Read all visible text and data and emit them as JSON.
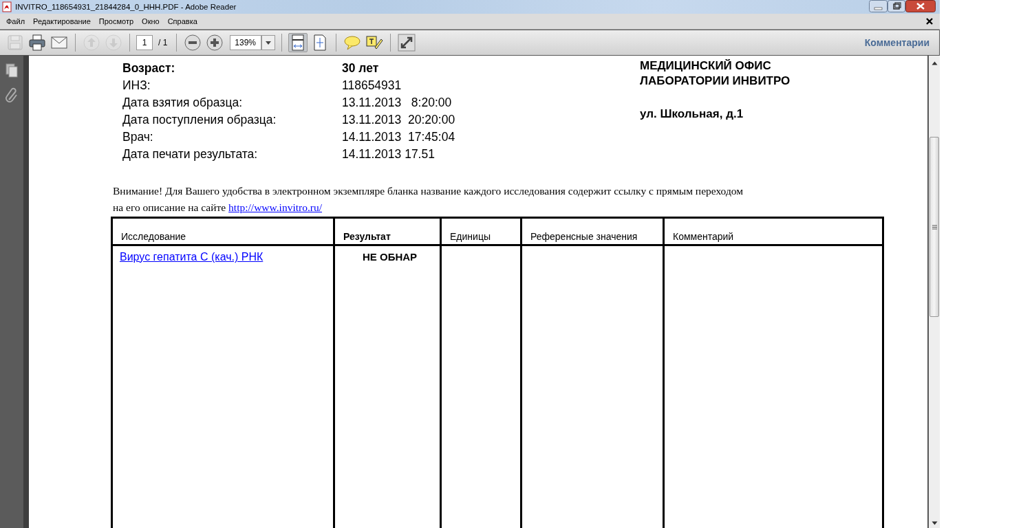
{
  "window": {
    "title": "INVITRO_118654931_21844284_0_HHH.PDF - Adobe Reader"
  },
  "menu": {
    "items": [
      "Файл",
      "Редактирование",
      "Просмотр",
      "Окно",
      "Справка"
    ]
  },
  "toolbar": {
    "groups": [
      [
        {
          "kind": "save",
          "disabled": true
        },
        {
          "kind": "print",
          "disabled": false
        },
        {
          "kind": "email",
          "disabled": false
        }
      ],
      [
        {
          "kind": "prev",
          "disabled": true
        },
        {
          "kind": "next",
          "disabled": true
        }
      ],
      [
        {
          "kind": "page"
        }
      ],
      [
        {
          "kind": "zoom-out",
          "disabled": false
        },
        {
          "kind": "zoom-in",
          "disabled": false
        },
        {
          "kind": "zoom"
        }
      ],
      [
        {
          "kind": "fit-width",
          "selected": true
        },
        {
          "kind": "fit-page",
          "selected": false
        }
      ],
      [
        {
          "kind": "comment",
          "disabled": false
        },
        {
          "kind": "highlight",
          "disabled": false
        }
      ],
      [
        {
          "kind": "fullscreen",
          "disabled": false
        }
      ]
    ],
    "page_number": "1",
    "page_total": "/ 1",
    "zoom": "139%",
    "comments": "Комментарии"
  },
  "document": {
    "fields": [
      {
        "label": "Возраст:",
        "value": "30 лет",
        "bold": true
      },
      {
        "label": "ИНЗ:",
        "value": "118654931",
        "bold": false
      },
      {
        "label": "Дата взятия образца:",
        "value": "13.11.2013   8:20:00",
        "bold": false
      },
      {
        "label": "Дата поступления образца:",
        "value": "13.11.2013  20:20:00",
        "bold": false
      },
      {
        "label": "Врач:",
        "value": "14.11.2013  17:45:04",
        "bold": false
      },
      {
        "label": "Дата печати результата:",
        "value": "14.11.2013 17.51",
        "bold": false
      }
    ],
    "office": [
      "МЕДИЦИНСКИЙ ОФИС",
      "ЛАБОРАТОРИИ ИНВИТРО"
    ],
    "address": "ул. Школьная, д.1",
    "notice": {
      "line_1": "Внимание! Для Вашего удобства в электронном экземпляре бланка название каждого исследования содержит ссылку с прямым переходом",
      "line_2": "на его описание на сайте",
      "link": "http://www.invitro.ru/"
    },
    "table": {
      "columns": [
        {
          "label": "Исследование",
          "bold": false
        },
        {
          "label": "Результат",
          "bold": true
        },
        {
          "label": "Единицы",
          "bold": false
        },
        {
          "label": "Референсные значения",
          "bold": false
        },
        {
          "label": "Комментарий",
          "bold": false
        }
      ],
      "rows": [
        {
          "test": "Вирус гепатита С (кач.) РНК",
          "result": "НЕ ОБНАР"
        }
      ]
    }
  }
}
